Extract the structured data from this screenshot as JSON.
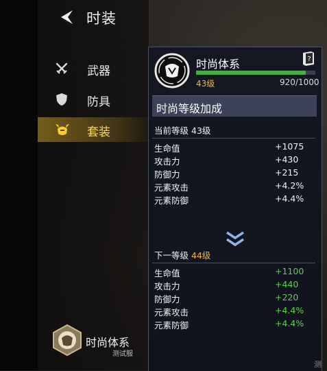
{
  "header": {
    "title": "时装"
  },
  "nav": [
    {
      "label": "武器",
      "icon": "swords-icon"
    },
    {
      "label": "防具",
      "icon": "shield-icon"
    },
    {
      "label": "套装",
      "icon": "horned-helmet-icon",
      "active": true
    }
  ],
  "footer_badge": {
    "name": "时尚体系",
    "server": "测试服"
  },
  "panel": {
    "system_name": "时尚体系",
    "level": "43级",
    "exp_text": "920/1000",
    "exp_progress": 0.92,
    "section_title": "时尚等级加成",
    "current_label": "当前等级",
    "current_level": "43级",
    "next_label": "下一等级",
    "next_level": "44级",
    "current_stats": [
      {
        "name": "生命值",
        "value": "+1075"
      },
      {
        "name": "攻击力",
        "value": "+430"
      },
      {
        "name": "防御力",
        "value": "+215"
      },
      {
        "name": "元素攻击",
        "value": "+4.2%"
      },
      {
        "name": "元素防御",
        "value": "+4.4%"
      }
    ],
    "next_stats": [
      {
        "name": "生命值",
        "value": "+1100"
      },
      {
        "name": "攻击力",
        "value": "+440"
      },
      {
        "name": "防御力",
        "value": "+220"
      },
      {
        "name": "元素攻击",
        "value": "+4.4%"
      },
      {
        "name": "元素防御",
        "value": "+4.4%"
      }
    ]
  },
  "watermark": "测",
  "colors": {
    "accent_gold": "#f0b53a",
    "bonus_green": "#58d24a",
    "progress": "#3fb53c",
    "section_bg": "#3b4259"
  }
}
